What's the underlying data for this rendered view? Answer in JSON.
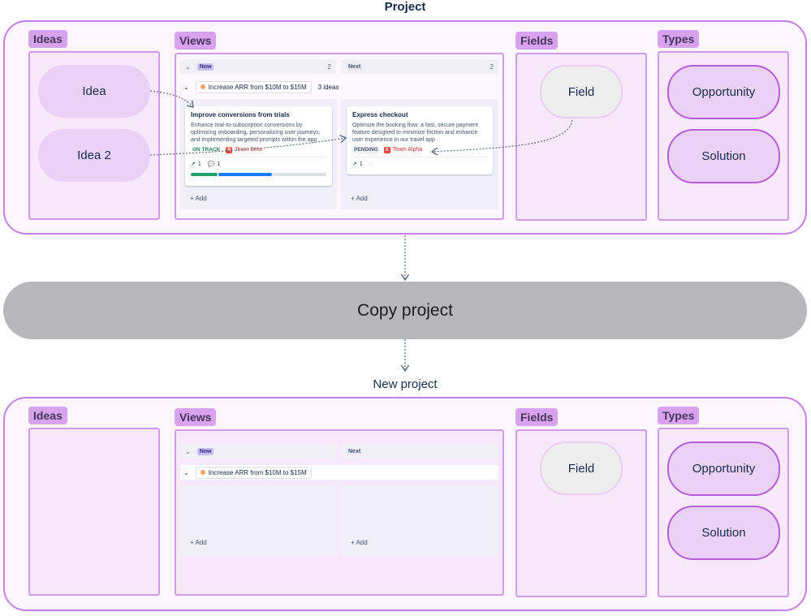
{
  "top": {
    "title": "Project",
    "ideas_tag": "Ideas",
    "views_tag": "Views",
    "fields_tag": "Fields",
    "types_tag": "Types",
    "ideas": [
      "Idea",
      "Idea 2"
    ],
    "field": "Field",
    "types": [
      "Opportunity",
      "Solution"
    ],
    "board": {
      "columns": [
        {
          "label": "Now",
          "count": "2"
        },
        {
          "label": "Next",
          "count": "2"
        }
      ],
      "group": {
        "goal": "Increase ARR from $10M to $15M",
        "count_label": "3 ideas"
      },
      "cards": [
        {
          "title": "Improve conversions from trials",
          "desc": "Enhance trial-to-subscription conversions by optimizing onboarding, personalizing user journeys, and implementing targeted prompts within the app",
          "status": "ON TRACK",
          "team": "Team Beta",
          "team_icon": "B",
          "metric1": "1",
          "metric2": "1",
          "progress": [
            0.2,
            0.4,
            0.4
          ]
        },
        {
          "title": "Express checkout",
          "desc": "Optimize the booking flow: a fast, secure payment feature designed to minimize friction and enhance user experience in our travel app",
          "status": "PENDING",
          "team": "Team Alpha",
          "team_icon": "A",
          "metric1": "1"
        }
      ],
      "add_label": "+ Add"
    }
  },
  "middle": {
    "copy_label": "Copy project"
  },
  "bottom": {
    "title": "New project",
    "ideas_tag": "Ideas",
    "views_tag": "Views",
    "fields_tag": "Fields",
    "types_tag": "Types",
    "field": "Field",
    "types": [
      "Opportunity",
      "Solution"
    ],
    "board": {
      "columns": [
        {
          "label": "Now"
        },
        {
          "label": "Next"
        }
      ],
      "group": {
        "goal": "Increase ARR from $10M to $15M"
      },
      "add_label": "+ Add"
    }
  },
  "colors": {
    "outer_border": "#c77fe4",
    "panel_bg": "#f7e8fb",
    "tag_bg": "#d9a2ee",
    "copy_bar": "#b8b8bc",
    "on_track": "#1f845a",
    "progress_green": "#22a06b",
    "progress_blue": "#1d7afc"
  }
}
